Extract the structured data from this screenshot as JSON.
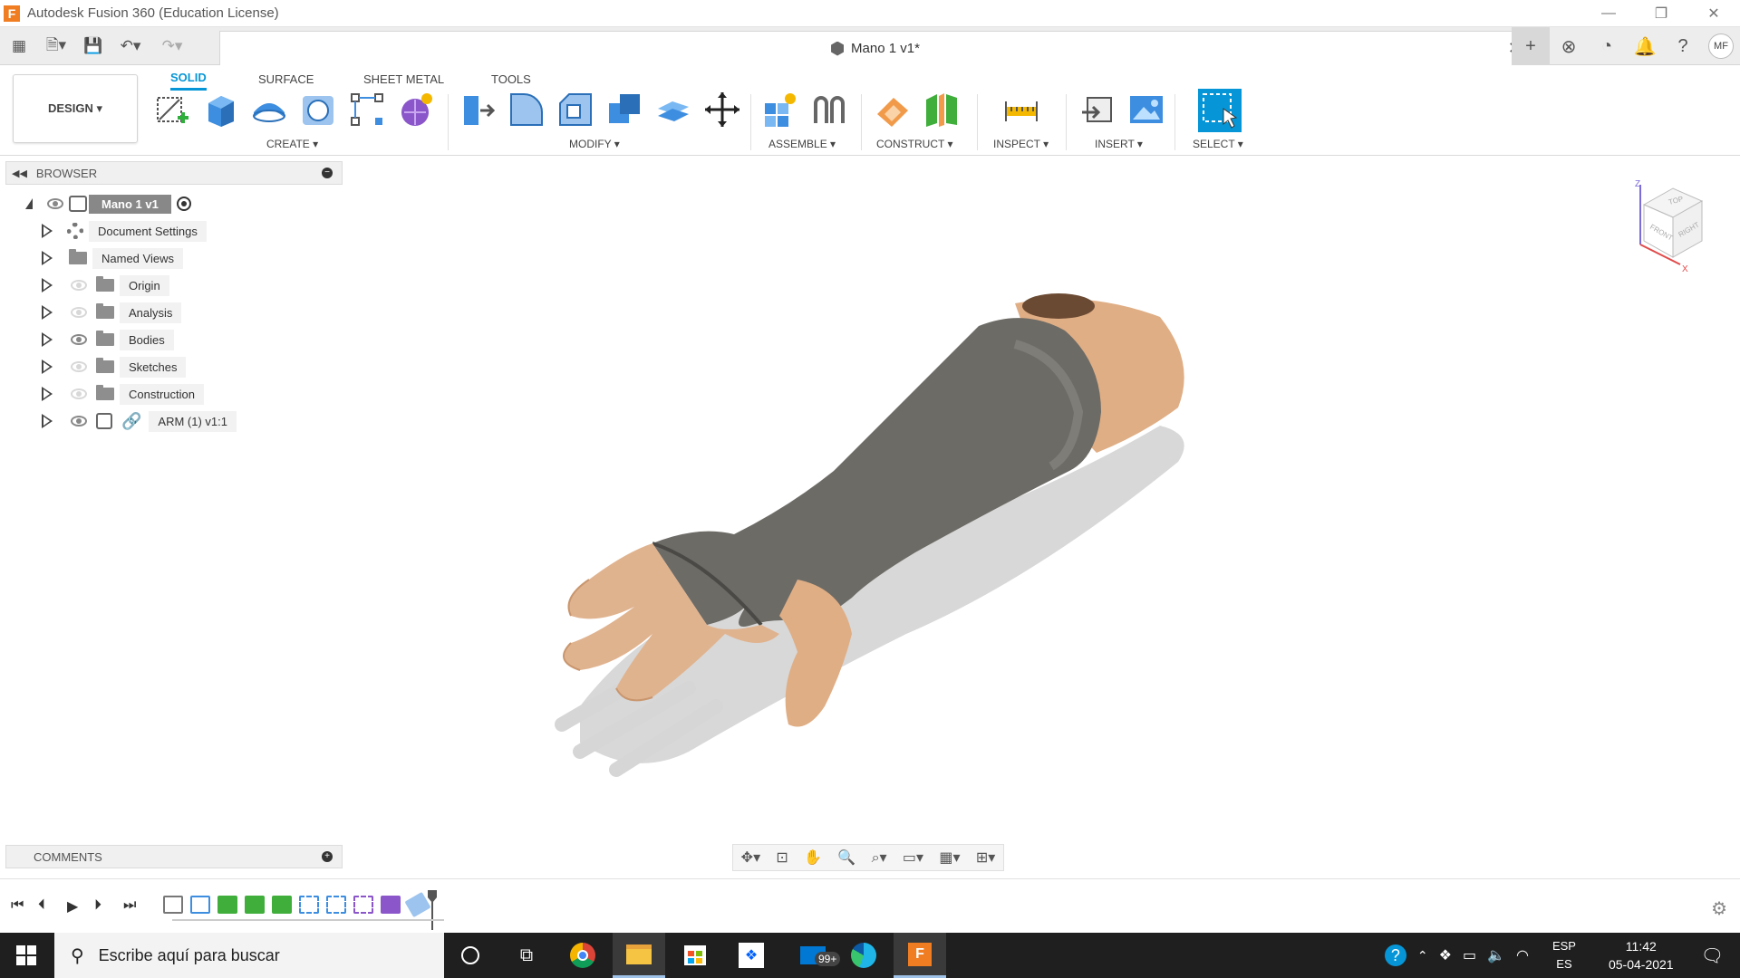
{
  "window": {
    "title": "Autodesk Fusion 360 (Education License)",
    "logo_letter": "F"
  },
  "document": {
    "name": "Mano 1 v1*"
  },
  "user": {
    "initials": "MF"
  },
  "ribbon": {
    "workspace": "DESIGN ▾",
    "tabs": [
      "SOLID",
      "SURFACE",
      "SHEET METAL",
      "TOOLS"
    ],
    "groups": {
      "create": "CREATE ▾",
      "modify": "MODIFY ▾",
      "assemble": "ASSEMBLE ▾",
      "construct": "CONSTRUCT ▾",
      "inspect": "INSPECT ▾",
      "insert": "INSERT ▾",
      "select": "SELECT ▾"
    }
  },
  "browser": {
    "title": "BROWSER",
    "root": "Mano 1 v1",
    "items": [
      {
        "label": "Document Settings"
      },
      {
        "label": "Named Views"
      },
      {
        "label": "Origin"
      },
      {
        "label": "Analysis"
      },
      {
        "label": "Bodies"
      },
      {
        "label": "Sketches"
      },
      {
        "label": "Construction"
      },
      {
        "label": "ARM (1) v1:1"
      }
    ]
  },
  "comments": {
    "title": "COMMENTS"
  },
  "viewcube": {
    "top": "TOP",
    "front": "FRONT",
    "right": "RIGHT",
    "axis_z": "Z",
    "axis_x": "X"
  },
  "taskbar": {
    "search_placeholder": "Escribe aquí para buscar",
    "mail_badge": "99+",
    "lang_top": "ESP",
    "lang_bottom": "ES",
    "time": "11:42",
    "date": "05-04-2021"
  },
  "colors": {
    "accent": "#0696d7",
    "skin": "#e0b38f",
    "brace": "#6d6b66",
    "taskbar": "#1f1f1f"
  }
}
